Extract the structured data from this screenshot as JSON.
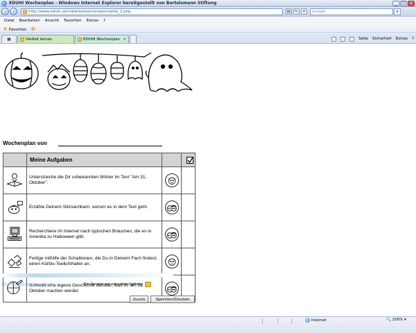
{
  "window": {
    "title": "EDUHI Wochenplan - Windows Internet Explorer bereitgestellt von Bertelsmann Stiftung",
    "url": "http://www.eduhi.at/material/wochenplan/seite_2.php",
    "search_placeholder": "Google"
  },
  "menu": [
    "Datei",
    "Bearbeiten",
    "Ansicht",
    "Favoriten",
    "Extras",
    "?"
  ],
  "favorites_bar": {
    "label": "Favoriten"
  },
  "tabs": [
    {
      "label": "Vielfalt lernen"
    },
    {
      "label": "EDUHI Wochenplan"
    }
  ],
  "command_bar": [
    "Seite",
    "Sicherheit",
    "Extras",
    "?"
  ],
  "page": {
    "wochenplan_label": "Wochenplan von",
    "table_header": "Meine Aufgaben",
    "tasks": [
      {
        "icon": "reading-book-icon",
        "face": "single-child-face-icon",
        "text": "Unterstreiche die Dir unbekannten Wörter im Text \"Am 31. Oktober\"."
      },
      {
        "icon": "talking-head-icon",
        "face": "pair-faces-icon",
        "text": "Erzähle Deinem Sitznachbarn, worum es in dem Text geht."
      },
      {
        "icon": "computer-icon",
        "face": "pair-faces-icon",
        "text": "Recherchiere im Internet nach typischen Bräuchen, die es in Amerika zu Halloween gibt."
      },
      {
        "icon": "crafting-hands-icon",
        "face": "single-child-face-icon",
        "text": "Fertige mithilfe der Schablonen, die Du in Deinem Fach findest, einen Kürbis-Teelichthalter an."
      },
      {
        "icon": "writing-hand-icon",
        "face": "pair-faces-icon",
        "text": "Schreibt eine eigene Geschichte darüber, was ihr am 31. Oktober machen werdet."
      }
    ],
    "generator_label": "Wochenplangenerator",
    "service_text": "Ein Service von education highway",
    "back_button": "Zurück",
    "save_button": "Speichern/Drucken"
  },
  "status": {
    "zone": "Internet",
    "zoom": "100%"
  }
}
